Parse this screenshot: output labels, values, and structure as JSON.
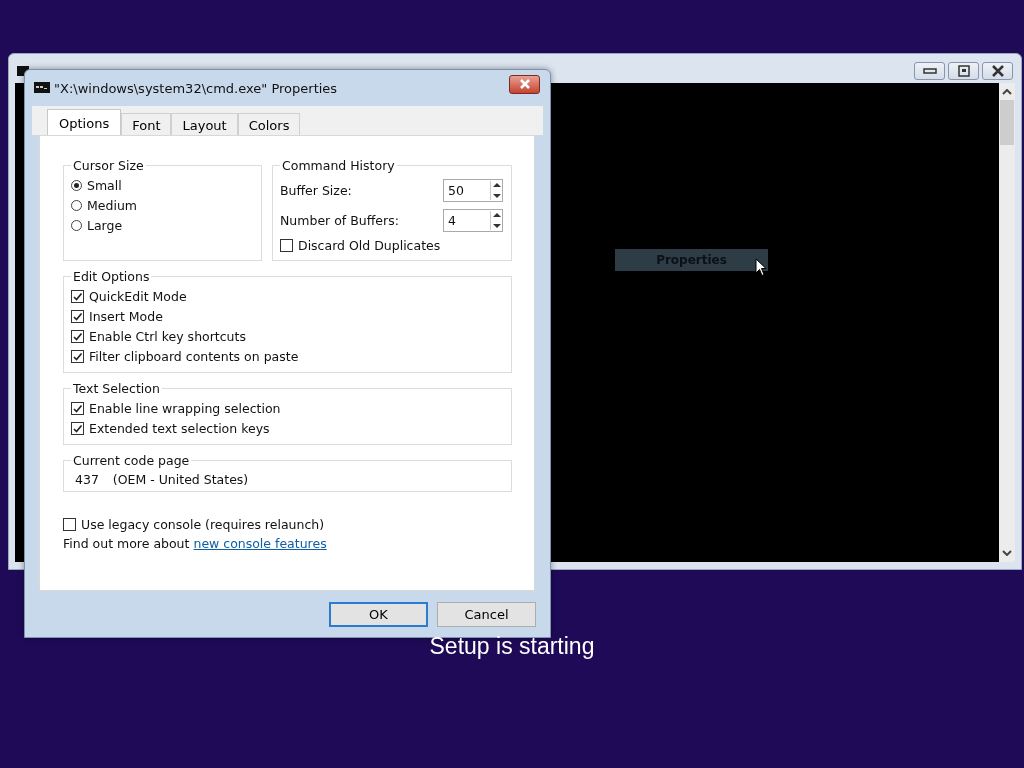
{
  "console_window": {
    "context_label": "Properties"
  },
  "dialog": {
    "title": "\"X:\\windows\\system32\\cmd.exe\" Properties",
    "tabs": [
      {
        "label": "Options",
        "selected": true
      },
      {
        "label": "Font",
        "selected": false
      },
      {
        "label": "Layout",
        "selected": false
      },
      {
        "label": "Colors",
        "selected": false
      }
    ],
    "cursor_size": {
      "title": "Cursor Size",
      "options": [
        {
          "label": "Small",
          "selected": true
        },
        {
          "label": "Medium",
          "selected": false
        },
        {
          "label": "Large",
          "selected": false
        }
      ]
    },
    "command_history": {
      "title": "Command History",
      "fields": [
        {
          "label": "Buffer Size:",
          "value": "50"
        },
        {
          "label": "Number of Buffers:",
          "value": "4"
        }
      ],
      "discard": {
        "label": "Discard Old Duplicates",
        "checked": false
      }
    },
    "edit_options": {
      "title": "Edit Options",
      "items": [
        {
          "label": "QuickEdit Mode",
          "checked": true
        },
        {
          "label": "Insert Mode",
          "checked": true
        },
        {
          "label": "Enable Ctrl key shortcuts",
          "checked": true
        },
        {
          "label": "Filter clipboard contents on paste",
          "checked": true
        }
      ]
    },
    "text_selection": {
      "title": "Text Selection",
      "items": [
        {
          "label": "Enable line wrapping selection",
          "checked": true
        },
        {
          "label": "Extended text selection keys",
          "checked": true
        }
      ]
    },
    "code_page": {
      "title": "Current code page",
      "number": "437",
      "name": "(OEM - United States)"
    },
    "legacy": {
      "label": "Use legacy console (requires relaunch)",
      "checked": false
    },
    "more": {
      "text": "Find out more about",
      "link": "new console features"
    },
    "buttons": [
      {
        "label": "OK",
        "default": true
      },
      {
        "label": "Cancel",
        "default": false
      }
    ]
  },
  "status_text": "Setup is starting"
}
